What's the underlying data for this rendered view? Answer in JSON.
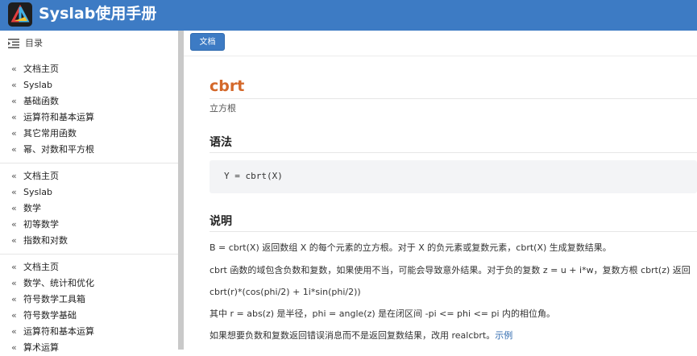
{
  "header": {
    "title": "Syslab使用手册"
  },
  "sidebar": {
    "toc_label": "目录",
    "groups": [
      {
        "items": [
          "文档主页",
          "Syslab",
          "基础函数",
          "运算符和基本运算",
          "其它常用函数",
          "幂、对数和平方根"
        ]
      },
      {
        "items": [
          "文档主页",
          "Syslab",
          "数学",
          "初等数学",
          "指数和对数"
        ]
      },
      {
        "items": [
          "文档主页",
          "数学、统计和优化",
          "符号数学工具箱",
          "符号数学基础",
          "运算符和基本运算",
          "算术运算"
        ]
      }
    ]
  },
  "main": {
    "breadcrumb_button": "文档",
    "title": "cbrt",
    "subtitle": "立方根",
    "syntax_heading": "语法",
    "syntax_code": "Y = cbrt(X)",
    "description_heading": "说明",
    "paragraphs": {
      "p1": "B = cbrt(X) 返回数组 X 的每个元素的立方根。对于 X 的负元素或复数元素，cbrt(X) 生成复数结果。",
      "p2a": "cbrt 函数的域包含负数和复数，如果使用不当，可能会导致意外结果。对于负的复数 z = u + i*w，复数方根 cbrt(z) 返回",
      "p2b": "cbrt(r)*(cos(phi/2) + 1i*sin(phi/2))",
      "p3": "其中 r = abs(z) 是半径，phi = angle(z) 是在闭区间 -pi <= phi <= pi 内的相位角。",
      "p4": "如果想要负数和复数返回错误消息而不是返回复数结果，改用 realcbrt。",
      "p4_link": "示例"
    }
  },
  "colors": {
    "header_bg": "#3d7bc4",
    "title_accent": "#d4682a",
    "link": "#2f6aaf"
  },
  "icons": {
    "logo": "syslab-logo-icon",
    "toc": "list-indent-icon",
    "nav": "double-chevron-left-icon"
  }
}
